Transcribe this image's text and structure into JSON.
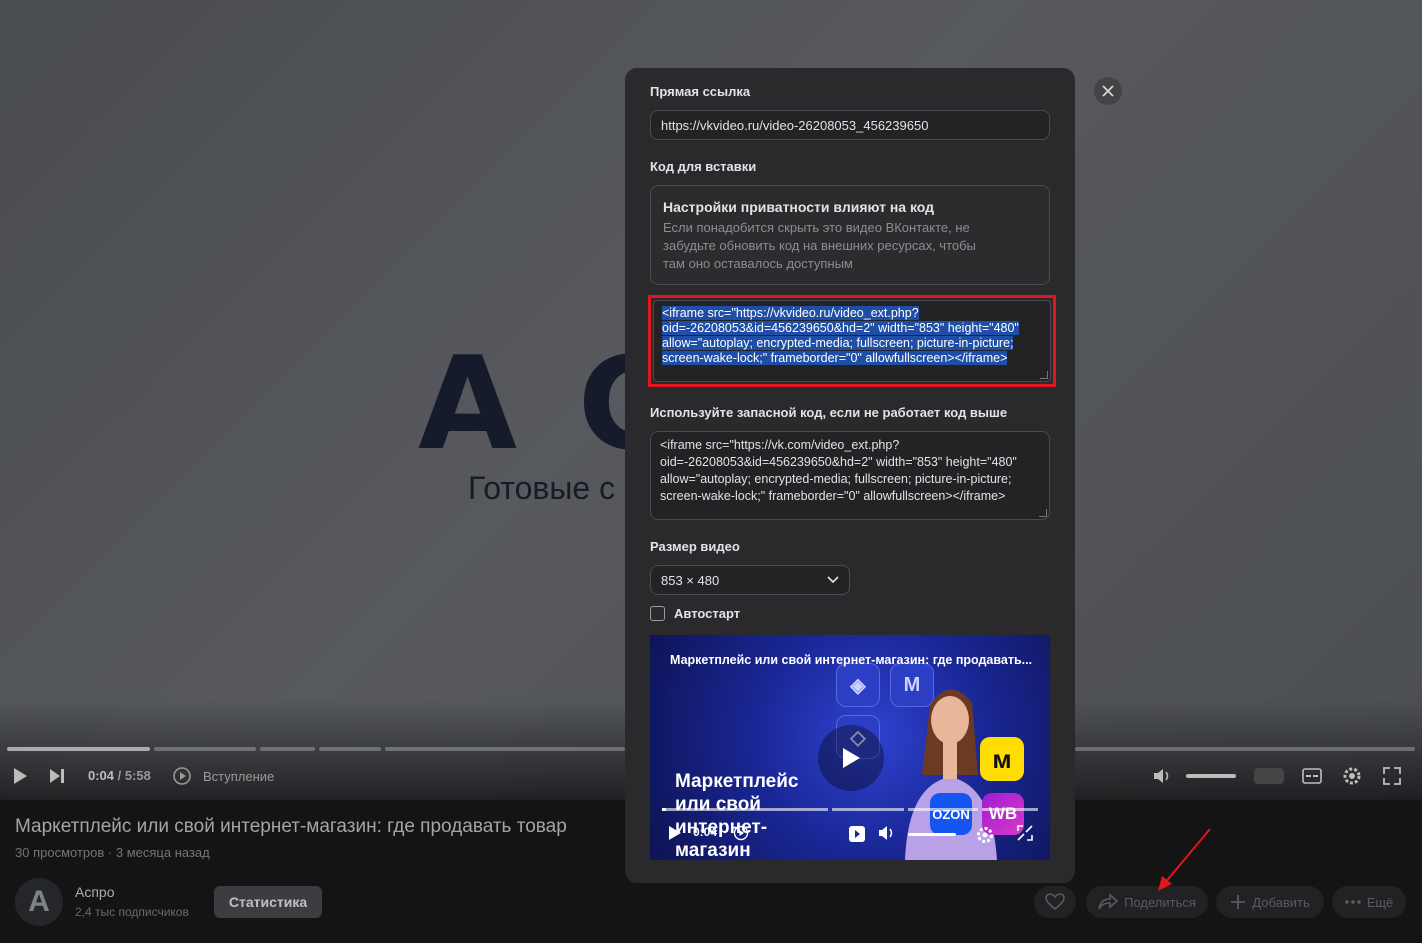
{
  "colors": {
    "accent_red": "#e0161c",
    "selection": "#1f4ea6",
    "modal_bg": "#2a2a2c"
  },
  "video": {
    "logo_text": "А С",
    "tagline": "Готовые с",
    "time_current": "0:04",
    "time_total": "5:58",
    "chapter": "Вступление"
  },
  "page": {
    "title": "Маркетплейс или свой интернет-магазин: где продавать товар",
    "views": "30 просмотров",
    "age": "3 месяца назад",
    "channel": {
      "avatar_letter": "A",
      "name": "Аспро",
      "subscribers": "2,4 тыс подписчиков"
    },
    "stats_button": "Статистика",
    "actions": {
      "share": "Поделиться",
      "add": "Добавить",
      "more": "Ещё"
    }
  },
  "share_modal": {
    "direct_link_label": "Прямая ссылка",
    "direct_link_value": "https://vkvideo.ru/video-26208053_456239650",
    "embed_label": "Код для вставки",
    "notice_title": "Настройки приватности влияют на код",
    "notice_text": "Если понадобится скрыть это видео ВКонтакте, не забудьте обновить код на внешних ресурсах, чтобы там оно оставалось доступным",
    "embed_code": "<iframe src=\"https://vkvideo.ru/video_ext.php?oid=-26208053&id=456239650&hd=2\" width=\"853\" height=\"480\" allow=\"autoplay; encrypted-media; fullscreen; picture-in-picture; screen-wake-lock;\" frameborder=\"0\" allowfullscreen></iframe>",
    "fallback_label": "Используйте запасной код, если не работает код выше",
    "fallback_code": "<iframe src=\"https://vk.com/video_ext.php?oid=-26208053&id=456239650&hd=2\" width=\"853\" height=\"480\" allow=\"autoplay; encrypted-media; fullscreen; picture-in-picture; screen-wake-lock;\" frameborder=\"0\" allowfullscreen></iframe>",
    "size_label": "Размер видео",
    "size_value": "853 × 480",
    "autoplay_label": "Автостарт",
    "autoplay_checked": false,
    "preview": {
      "title": "Маркетплейс или свой интернет-магазин: где продавать...",
      "overlay_text": "Маркетплейс или свой интернет-магазин",
      "time": "0:04",
      "ozon_label": "OZON",
      "wb_label": "WB",
      "progress": 0.01
    }
  }
}
